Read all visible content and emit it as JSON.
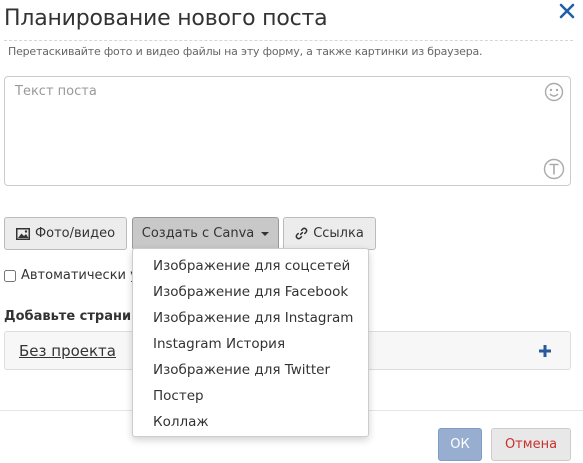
{
  "dialog": {
    "title": "Планирование нового поста",
    "hint": "Перетаскивайте фото и видео файлы на эту форму, а также картинки из браузера."
  },
  "post": {
    "placeholder": "Текст поста",
    "value": ""
  },
  "toolbar": {
    "photo_label": "Фото/видео",
    "canva_label": "Создать с Canva",
    "link_label": "Ссылка"
  },
  "canva_menu": {
    "items": [
      "Изображение для соцсетей",
      "Изображение для Facebook",
      "Изображение для Instagram",
      "Instagram История",
      "Изображение для Twitter",
      "Постер",
      "Коллаж"
    ]
  },
  "auto_option": {
    "label": "Автоматически у",
    "checked": false
  },
  "pages": {
    "label": "Добавьте страниц",
    "project": "Без проекта"
  },
  "footer": {
    "ok_label": "ОК",
    "cancel_label": "Отмена"
  },
  "colors": {
    "ok_button": "#97aed0",
    "cancel_text": "#c9302c",
    "close_icon": "#1f5fa8",
    "plus_icon": "#2a5a9a"
  }
}
